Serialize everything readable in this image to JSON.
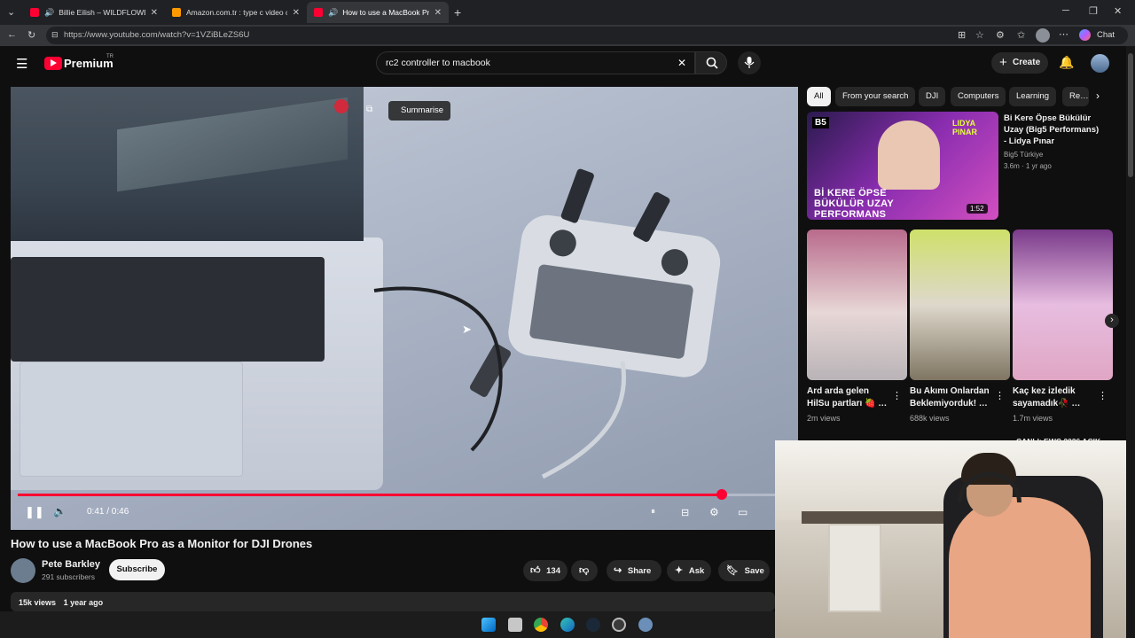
{
  "browser": {
    "tabs": [
      {
        "title": "Billie Eilish – WILDFLOWER (L…",
        "favicon_color": "#ff0033"
      },
      {
        "title": "Amazon.com.tr : type c video capt…",
        "favicon_color": "#ff9900"
      },
      {
        "title": "How to use a MacBook Pro as…",
        "favicon_color": "#ff0033"
      }
    ],
    "url": "https://www.youtube.com/watch?v=1VZiBLeZS6U",
    "chat_label": "Chat"
  },
  "header": {
    "logo_text": "Premium",
    "region_badge": "TR",
    "search_query": "rc2 controller to macbook",
    "create_label": "Create"
  },
  "player": {
    "summarise_label": "Summarise",
    "time": "0:41 / 0:46",
    "progress_fraction": 0.91
  },
  "video": {
    "title": "How to use a MacBook Pro as a Monitor for DJI Drones",
    "channel": "Pete Barkley",
    "subscribers": "291 subscribers",
    "subscribe_label": "Subscribe",
    "likes": "134",
    "share_label": "Share",
    "ask_label": "Ask",
    "save_label": "Save",
    "views": "15k views",
    "age": "1 year ago"
  },
  "sidebar": {
    "chips": [
      "All",
      "From your search",
      "DJI",
      "Computers",
      "Learning",
      "Re…"
    ],
    "recommended": {
      "title": "Bi Kere Öpse Bükülür Uzay (Big5 Performans) - Lidya Pınar",
      "channel": "Big5 Türkiye",
      "stats": "3.6m · 1 yr ago",
      "duration": "1:52",
      "badge": "B5",
      "thumb_artist": "LIDYA PINAR",
      "thumb_text": "Bİ KERE ÖPSE BÜKÜLÜR UZAY PERFORMANS"
    },
    "shorts": [
      {
        "title": "Ard arda gelen HilSu partları 🍓 …",
        "views": "2m views"
      },
      {
        "title": "Bu Akımı Onlardan Beklemiyorduk! …",
        "views": "688k views"
      },
      {
        "title": "Kaç kez izledik sayamadık🥀 …",
        "views": "1.7m views"
      }
    ],
    "partial_item": "CANLI: EWC 2026 AÇIK"
  }
}
